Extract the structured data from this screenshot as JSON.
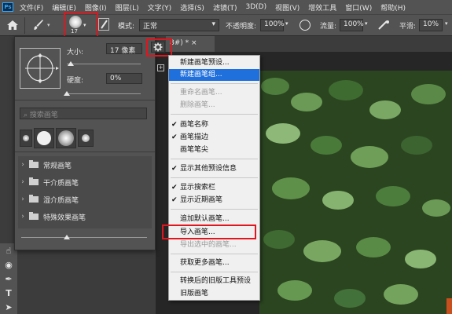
{
  "menubar": {
    "logo": "Ps",
    "items": [
      "文件(F)",
      "编辑(E)",
      "图像(I)",
      "图层(L)",
      "文字(Y)",
      "选择(S)",
      "滤镜(T)",
      "3D(D)",
      "视图(V)",
      "增效工具",
      "窗口(W)",
      "帮助(H)"
    ]
  },
  "options": {
    "brush_size": "17",
    "mode_label": "模式:",
    "mode_value": "正常",
    "opacity_label": "不透明度:",
    "opacity_value": "100%",
    "flow_label": "流量:",
    "flow_value": "100%",
    "smooth_label": "平滑:",
    "smooth_value": "10%"
  },
  "document_tab": {
    "title": "8#) * ×"
  },
  "brush_panel": {
    "size_label": "大小:",
    "size_value": "17 像素",
    "hardness_label": "硬度:",
    "hardness_value": "0%",
    "size_level": 0.05,
    "hardness_level": 0,
    "search_placeholder": "搜索画笔",
    "presets": [
      "",
      "",
      "",
      ""
    ],
    "folders": [
      "常规画笔",
      "干介质画笔",
      "湿介质画笔",
      "特殊效果画笔"
    ]
  },
  "context_menu": {
    "items": [
      {
        "label": "新建画笔预设...",
        "checked": false,
        "disabled": false,
        "highlighted": false
      },
      {
        "label": "新建画笔组...",
        "checked": false,
        "disabled": false,
        "highlighted": true
      },
      {
        "label": "重命名画笔...",
        "checked": false,
        "disabled": true,
        "highlighted": false
      },
      {
        "label": "删除画笔...",
        "checked": false,
        "disabled": true,
        "highlighted": false
      },
      {
        "label": "画笔名称",
        "checked": true,
        "disabled": false,
        "highlighted": false
      },
      {
        "label": "画笔描边",
        "checked": true,
        "disabled": false,
        "highlighted": false
      },
      {
        "label": "画笔笔尖",
        "checked": false,
        "disabled": false,
        "highlighted": false
      },
      {
        "label": "显示其他预设信息",
        "checked": true,
        "disabled": false,
        "highlighted": false
      },
      {
        "label": "显示搜索栏",
        "checked": true,
        "disabled": false,
        "highlighted": false
      },
      {
        "label": "显示近期画笔",
        "checked": true,
        "disabled": false,
        "highlighted": false
      },
      {
        "label": "追加默认画笔...",
        "checked": false,
        "disabled": false,
        "highlighted": false
      },
      {
        "label": "导入画笔...",
        "checked": false,
        "disabled": false,
        "highlighted": false
      },
      {
        "label": "导出选中的画笔...",
        "checked": false,
        "disabled": true,
        "highlighted": false
      },
      {
        "label": "获取更多画笔...",
        "checked": false,
        "disabled": false,
        "highlighted": false
      },
      {
        "label": "转换后的旧版工具预设",
        "checked": false,
        "disabled": false,
        "highlighted": false
      },
      {
        "label": "旧版画笔",
        "checked": false,
        "disabled": false,
        "highlighted": false
      }
    ]
  },
  "colors": {
    "highlight": "#1f6fdd",
    "annotation_red": "#e0161f",
    "panel_bg": "#535353"
  }
}
